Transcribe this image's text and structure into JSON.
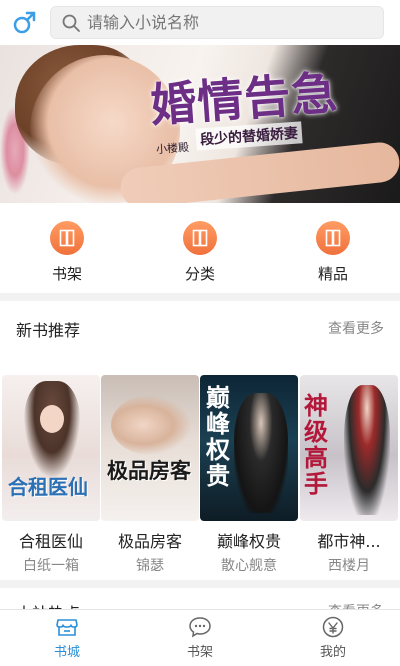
{
  "header": {
    "gender_icon": "male-symbol-icon",
    "search_placeholder": "请输入小说名称",
    "search_icon": "search-icon"
  },
  "banner": {
    "title": "婚情告急",
    "subtitle": "段少的替婚娇妻",
    "author": "小楼殿"
  },
  "quick_nav": [
    {
      "label": "书架",
      "icon": "book-icon"
    },
    {
      "label": "分类",
      "icon": "book-icon"
    },
    {
      "label": "精品",
      "icon": "book-icon"
    }
  ],
  "new_books": {
    "title": "新书推荐",
    "more": "查看更多",
    "books": [
      {
        "name": "合租医仙",
        "author": "白纸一箱",
        "cover_text": "合租医仙"
      },
      {
        "name": "极品房客",
        "author": "锦瑟",
        "cover_text": "极品房客"
      },
      {
        "name": "巅峰权贵",
        "author": "散心舰意",
        "cover_text": "巅峰权贵"
      },
      {
        "name": "都市神...",
        "author": "西楼月",
        "cover_text": "神级高手"
      }
    ]
  },
  "next_section": {
    "title": "本站热点",
    "more": "查看更多"
  },
  "tabbar": [
    {
      "label": "书城",
      "icon": "store-icon",
      "active": true
    },
    {
      "label": "书架",
      "icon": "chat-bubble-icon",
      "active": false
    },
    {
      "label": "我的",
      "icon": "user-circle-icon",
      "active": false
    }
  ],
  "colors": {
    "accent_orange": "#f0713c",
    "active_blue": "#2a8fd8"
  }
}
